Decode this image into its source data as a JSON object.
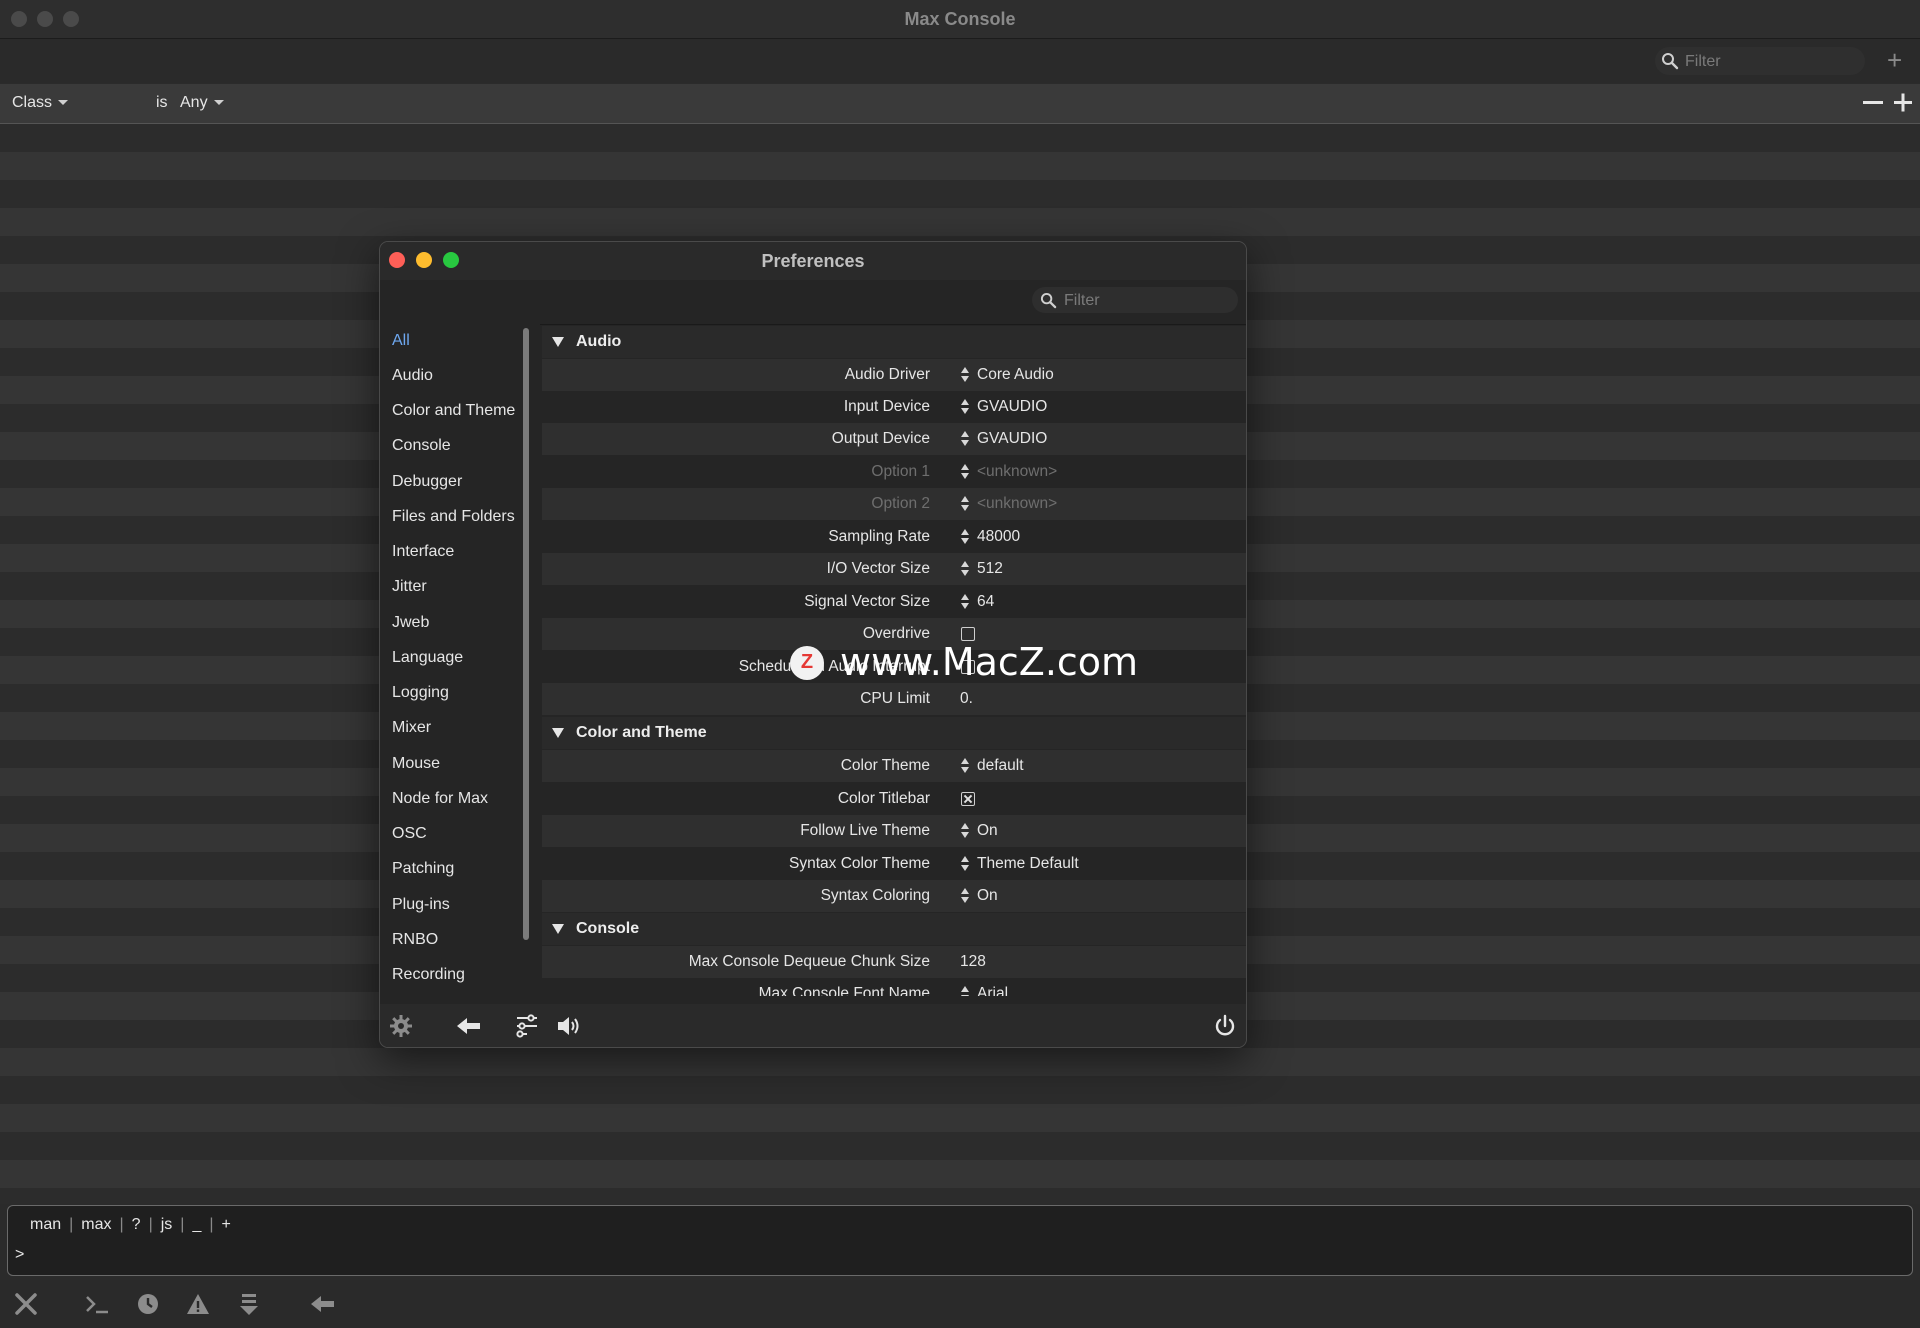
{
  "window": {
    "title": "Max Console"
  },
  "filter": {
    "placeholder": "Filter"
  },
  "rule": {
    "field": "Class",
    "operator": "is",
    "value": "Any"
  },
  "command_tabs": [
    "man",
    "max",
    "?",
    "js",
    "_",
    "+"
  ],
  "prompt": ">",
  "prefs": {
    "title": "Preferences",
    "filter_placeholder": "Filter",
    "sidebar": [
      "All",
      "Audio",
      "Color and Theme",
      "Console",
      "Debugger",
      "Files and Folders",
      "Interface",
      "Jitter",
      "Jweb",
      "Language",
      "Logging",
      "Mixer",
      "Mouse",
      "Node for Max",
      "OSC",
      "Patching",
      "Plug-ins",
      "RNBO",
      "Recording"
    ],
    "sections": [
      {
        "title": "Audio",
        "rows": [
          {
            "label": "Audio Driver",
            "control": "spinner",
            "value": "Core Audio"
          },
          {
            "label": "Input Device",
            "control": "spinner",
            "value": "GVAUDIO"
          },
          {
            "label": "Output Device",
            "control": "spinner",
            "value": "GVAUDIO"
          },
          {
            "label": "Option 1",
            "control": "spinner",
            "value": "<unknown>",
            "disabled": true
          },
          {
            "label": "Option 2",
            "control": "spinner",
            "value": "<unknown>",
            "disabled": true
          },
          {
            "label": "Sampling Rate",
            "control": "spinner",
            "value": "48000"
          },
          {
            "label": "I/O Vector Size",
            "control": "spinner",
            "value": "512"
          },
          {
            "label": "Signal Vector Size",
            "control": "spinner",
            "value": "64"
          },
          {
            "label": "Overdrive",
            "control": "checkbox",
            "checked": false
          },
          {
            "label": "Scheduler in Audio Interrupt",
            "control": "checkbox",
            "checked": false
          },
          {
            "label": "CPU Limit",
            "control": "text",
            "value": "0."
          }
        ]
      },
      {
        "title": "Color and Theme",
        "rows": [
          {
            "label": "Color Theme",
            "control": "spinner",
            "value": "default"
          },
          {
            "label": "Color Titlebar",
            "control": "checkbox",
            "checked": true
          },
          {
            "label": "Follow Live Theme",
            "control": "spinner",
            "value": "On"
          },
          {
            "label": "Syntax Color Theme",
            "control": "spinner",
            "value": "Theme Default"
          },
          {
            "label": "Syntax Coloring",
            "control": "spinner",
            "value": "On"
          }
        ]
      },
      {
        "title": "Console",
        "rows": [
          {
            "label": "Max Console Dequeue Chunk Size",
            "control": "text",
            "value": "128"
          },
          {
            "label": "Max Console Font Name",
            "control": "spinner",
            "value": "Arial"
          }
        ]
      }
    ]
  },
  "watermark": {
    "badge": "Z",
    "text": "www.MacZ.com"
  },
  "colors": {
    "accent": "#6ea8f0",
    "close": "#ff5f57",
    "minimize": "#febc2e",
    "zoom": "#28c840"
  },
  "icons": {
    "prefs_toolbar": [
      "gear-icon",
      "back-arrow-icon",
      "mixer-settings-icon",
      "speaker-icon",
      "power-icon"
    ],
    "console_toolbar": [
      "clear-icon",
      "terminal-icon",
      "clock-icon",
      "warning-icon",
      "scroll-down-icon",
      "back-arrow-icon"
    ]
  }
}
